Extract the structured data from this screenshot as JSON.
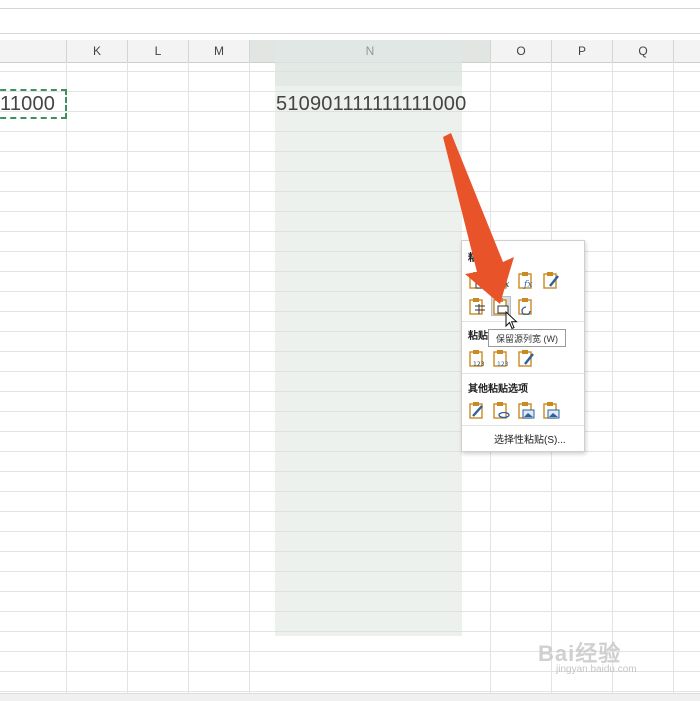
{
  "columns": [
    {
      "label": "K"
    },
    {
      "label": "L"
    },
    {
      "label": "M"
    },
    {
      "label": "N"
    },
    {
      "label": "O"
    },
    {
      "label": "P"
    },
    {
      "label": "Q"
    }
  ],
  "cells": {
    "copied_value": "11000",
    "pasted_value": "510901111111111000"
  },
  "paste_menu": {
    "section1_title": "粘贴",
    "section2_title": "粘贴",
    "section3_title": "其他粘贴选项",
    "special_paste": "选择性粘贴(S)...",
    "row1_icons": [
      "paste-icon",
      "paste-formulas-icon",
      "paste-formulas-number-format-icon",
      "keep-source-formatting-icon"
    ],
    "row2_icons": [
      "no-borders-icon",
      "keep-source-column-widths-icon",
      "transpose-icon"
    ],
    "values_icons": [
      "paste-values-icon",
      "values-number-format-icon",
      "values-source-formatting-icon"
    ],
    "other_icons": [
      "formatting-icon",
      "paste-link-icon",
      "picture-icon",
      "linked-picture-icon"
    ]
  },
  "tooltip": "保留源列宽 (W)",
  "watermark": {
    "brand": "Bai经验",
    "sub": "jingyan.baidu.com"
  },
  "colors": {
    "arrow": "#e8532a",
    "copy_border": "#3f8f63",
    "selection": "#d7e1da"
  }
}
